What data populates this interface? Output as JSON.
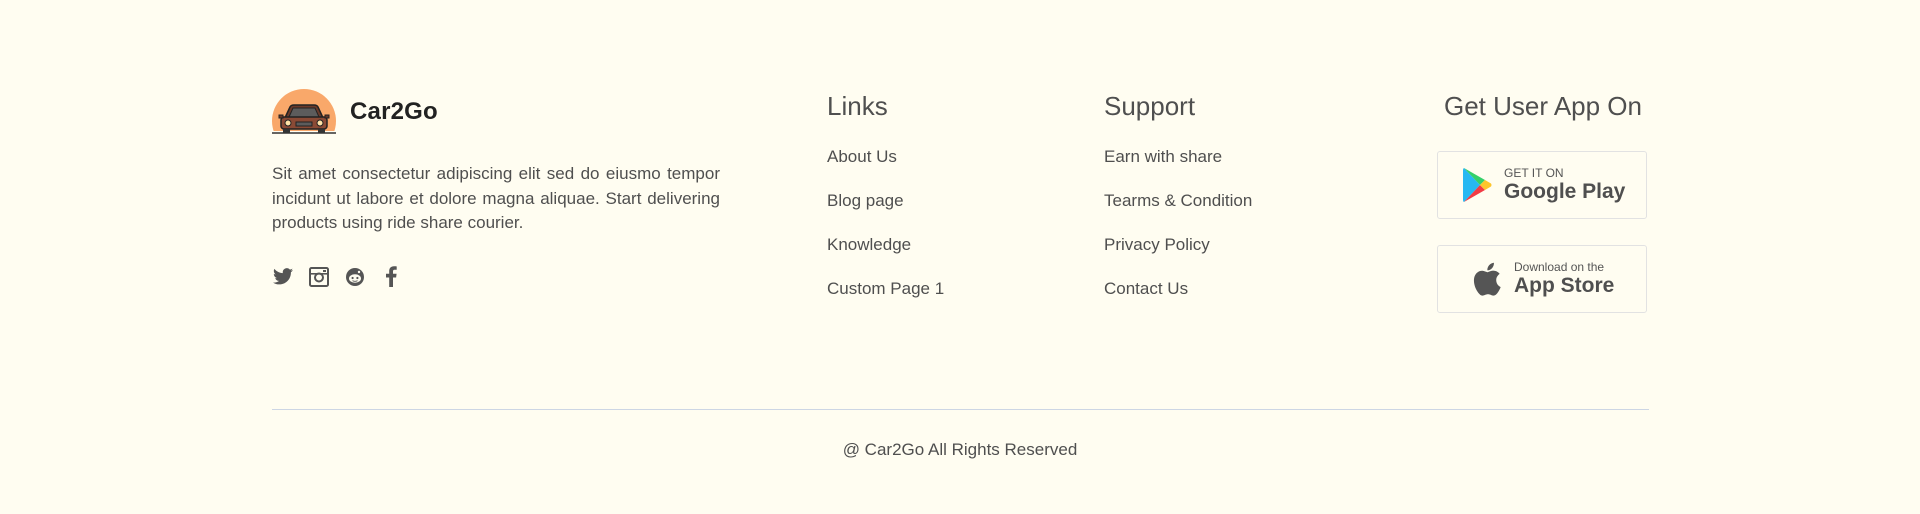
{
  "brand": {
    "name": "Car2Go",
    "description": "Sit amet consectetur adipiscing elit sed do eiusmo tempor incidunt ut labore et dolore magna aliquae. Start delivering products using ride share courier.",
    "logo_icon": "car-logo-icon",
    "logo_color": "#f9a86a"
  },
  "socials": [
    {
      "icon": "twitter-icon"
    },
    {
      "icon": "instagram-icon"
    },
    {
      "icon": "reddit-icon"
    },
    {
      "icon": "facebook-icon"
    }
  ],
  "links": {
    "title": "Links",
    "items": [
      "About Us",
      "Blog page",
      "Knowledge",
      "Custom Page 1"
    ]
  },
  "support": {
    "title": "Support",
    "items": [
      "Earn with share",
      "Tearms & Condition",
      "Privacy Policy",
      "Contact Us"
    ]
  },
  "app": {
    "title": "Get User App On",
    "google_play": {
      "small": "GET IT ON",
      "big": "Google Play",
      "icon": "google-play-icon"
    },
    "app_store": {
      "small": "Download on the",
      "big": "App Store",
      "icon": "apple-icon"
    }
  },
  "footer": {
    "copyright": "@ Car2Go All Rights Reserved"
  },
  "colors": {
    "background": "#fffdf1",
    "text": "#4f4f4f",
    "divider": "#cdd6e4",
    "logo_circle": "#f9a86a"
  }
}
